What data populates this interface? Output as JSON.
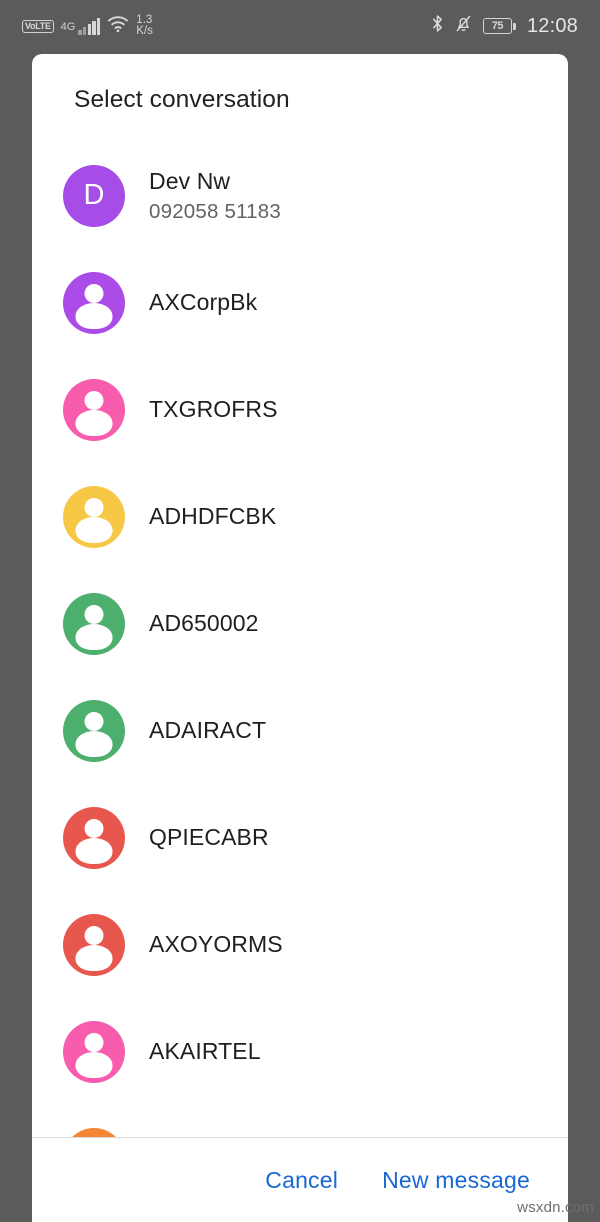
{
  "status_bar": {
    "volte_label": "VoLTE",
    "network_type": "4G",
    "network_speed_value": "1.3",
    "network_speed_unit": "K/s",
    "battery_percent": "75",
    "time": "12:08",
    "icons": [
      "volte-icon",
      "signal-bars-icon",
      "wifi-icon",
      "bluetooth-icon",
      "notifications-muted-icon",
      "battery-icon"
    ]
  },
  "dialog": {
    "title": "Select conversation",
    "conversations": [
      {
        "name": "Dev Nw",
        "subtitle": "092058 51183",
        "avatar_color": "#a64de8",
        "avatar_letter": "D",
        "avatar_type": "letter"
      },
      {
        "name": "AXCorpBk",
        "subtitle": "",
        "avatar_color": "#ab4ce8",
        "avatar_letter": "",
        "avatar_type": "person"
      },
      {
        "name": "TXGROFRS",
        "subtitle": "",
        "avatar_color": "#f75cad",
        "avatar_letter": "",
        "avatar_type": "person"
      },
      {
        "name": "ADHDFCBK",
        "subtitle": "",
        "avatar_color": "#f7c846",
        "avatar_letter": "",
        "avatar_type": "person"
      },
      {
        "name": "AD650002",
        "subtitle": "",
        "avatar_color": "#4caf6e",
        "avatar_letter": "",
        "avatar_type": "person"
      },
      {
        "name": "ADAIRACT",
        "subtitle": "",
        "avatar_color": "#4caf6e",
        "avatar_letter": "",
        "avatar_type": "person"
      },
      {
        "name": "QPIECABR",
        "subtitle": "",
        "avatar_color": "#e8574d",
        "avatar_letter": "",
        "avatar_type": "person"
      },
      {
        "name": "AXOYORMS",
        "subtitle": "",
        "avatar_color": "#e8574d",
        "avatar_letter": "",
        "avatar_type": "person"
      },
      {
        "name": "AKAIRTEL",
        "subtitle": "",
        "avatar_color": "#f75cad",
        "avatar_letter": "",
        "avatar_type": "person"
      },
      {
        "name": "",
        "subtitle": "",
        "avatar_color": "#f58634",
        "avatar_letter": "",
        "avatar_type": "person"
      }
    ],
    "footer": {
      "cancel_label": "Cancel",
      "new_message_label": "New message",
      "accent_color": "#1967d2"
    }
  },
  "watermark": "wsxdn.com"
}
